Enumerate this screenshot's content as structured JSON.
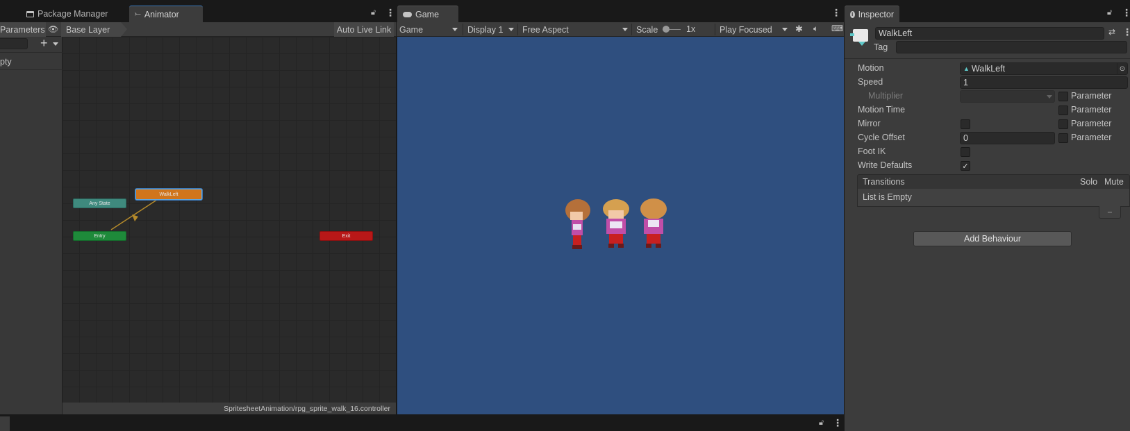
{
  "tabs": {
    "package_manager": "Package Manager",
    "animator": "Animator",
    "game": "Game",
    "inspector": "Inspector"
  },
  "animator": {
    "parameters_tab": "Parameters",
    "layer": "Base Layer",
    "auto_live_link": "Auto Live Link",
    "list_empty_partial": "pty",
    "path": "SpritesheetAnimation/rpg_sprite_walk_16.controller",
    "nodes": {
      "any_state": "Any State",
      "walk_left": "WalkLeft",
      "entry": "Entry",
      "exit": "Exit"
    }
  },
  "game": {
    "view_select": "Game",
    "display": "Display 1",
    "aspect": "Free Aspect",
    "scale_label": "Scale",
    "scale_value": "1x",
    "play_mode": "Play Focused",
    "background_color": "#2f4f7f"
  },
  "inspector": {
    "name": "WalkLeft",
    "tag_label": "Tag",
    "motion_label": "Motion",
    "motion_value": "WalkLeft",
    "speed_label": "Speed",
    "speed_value": "1",
    "multiplier_label": "Multiplier",
    "parameter_label": "Parameter",
    "motion_time_label": "Motion Time",
    "mirror_label": "Mirror",
    "cycle_offset_label": "Cycle Offset",
    "cycle_offset_value": "0",
    "foot_ik_label": "Foot IK",
    "write_defaults_label": "Write Defaults",
    "transitions_label": "Transitions",
    "solo_label": "Solo",
    "mute_label": "Mute",
    "list_empty": "List is Empty",
    "minus": "−",
    "add_behaviour": "Add Behaviour"
  }
}
